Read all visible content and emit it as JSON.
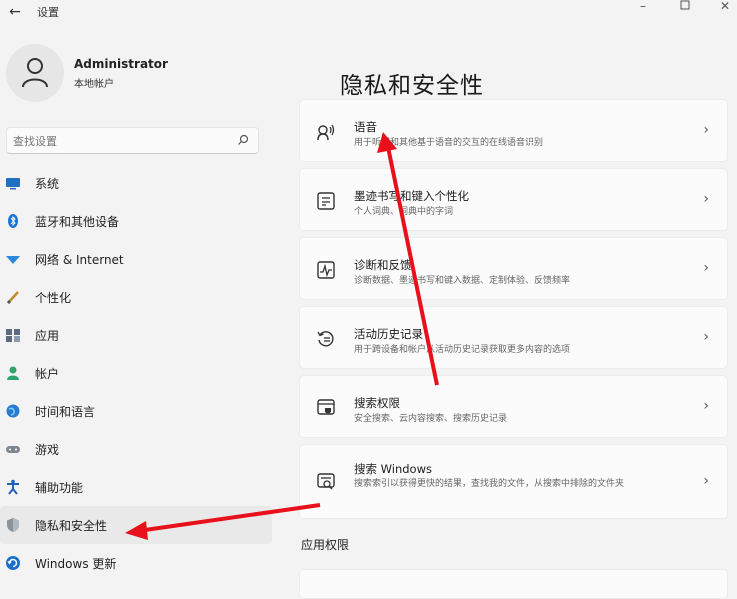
{
  "window": {
    "title": "设置",
    "back_icon": "back-arrow-icon",
    "min_icon": "minimize-icon",
    "max_icon": "maximize-icon",
    "close_icon": "close-icon"
  },
  "profile": {
    "name": "Administrator",
    "account_type": "本地帐户",
    "avatar_icon": "person-icon"
  },
  "search": {
    "placeholder": "查找设置",
    "icon": "search-icon"
  },
  "sidebar": {
    "items": [
      {
        "label": "系统",
        "icon": "system-icon"
      },
      {
        "label": "蓝牙和其他设备",
        "icon": "bluetooth-icon"
      },
      {
        "label": "网络 & Internet",
        "icon": "network-icon"
      },
      {
        "label": "个性化",
        "icon": "brush-icon"
      },
      {
        "label": "应用",
        "icon": "apps-icon"
      },
      {
        "label": "帐户",
        "icon": "account-icon"
      },
      {
        "label": "时间和语言",
        "icon": "globe-icon"
      },
      {
        "label": "游戏",
        "icon": "gamepad-icon"
      },
      {
        "label": "辅助功能",
        "icon": "accessibility-icon"
      },
      {
        "label": "隐私和安全性",
        "icon": "shield-icon",
        "selected": true
      },
      {
        "label": "Windows 更新",
        "icon": "update-icon"
      }
    ]
  },
  "main": {
    "title": "隐私和安全性",
    "cards": [
      {
        "title": "语音",
        "desc": "用于听写和其他基于语音的交互的在线语音识别",
        "icon": "speech-icon"
      },
      {
        "title": "墨迹书写和键入个性化",
        "desc": "个人词典、词典中的字词",
        "icon": "ink-icon"
      },
      {
        "title": "诊断和反馈",
        "desc": "诊断数据、墨迹书写和键入数据、定制体验、反馈频率",
        "icon": "diagnostics-icon"
      },
      {
        "title": "活动历史记录",
        "desc": "用于跨设备和帐户从活动历史记录获取更多内容的选项",
        "icon": "history-icon"
      },
      {
        "title": "搜索权限",
        "desc": "安全搜索、云内容搜索、搜索历史记录",
        "icon": "search-permissions-icon"
      },
      {
        "title": "搜索 Windows",
        "desc": "搜索索引以获得更快的结果，查找我的文件，从搜索中排除的文件夹",
        "icon": "search-windows-icon"
      }
    ],
    "section_label": "应用权限"
  },
  "colors": {
    "arrow": "#e8101a",
    "background": "#f3f3f3",
    "card": "#fbfbfb"
  }
}
